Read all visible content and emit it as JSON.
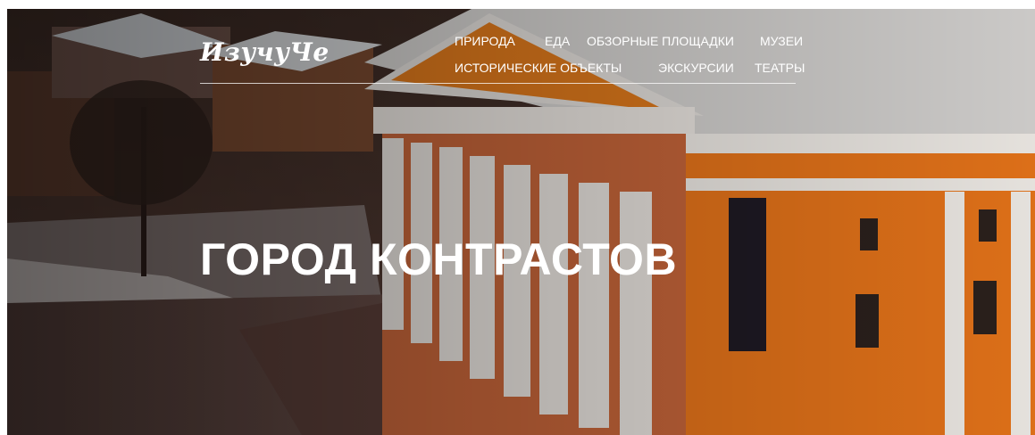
{
  "brand": {
    "logo_text": "ИзучуЧе"
  },
  "nav": {
    "items": [
      "ПРИРОДА",
      "ЕДА",
      "ОБЗОРНЫЕ ПЛОЩАДКИ",
      "МУЗЕИ",
      "ИСТОРИЧЕСКИЕ ОБЪЕКТЫ",
      "ЭКСКУРСИИ",
      "ТЕАТРЫ"
    ]
  },
  "hero": {
    "title": "ГОРОД КОНТРАСТОВ",
    "image_subject": "theatre-building-with-columns"
  },
  "colors": {
    "facade": "#e8751a",
    "text": "#ffffff"
  }
}
